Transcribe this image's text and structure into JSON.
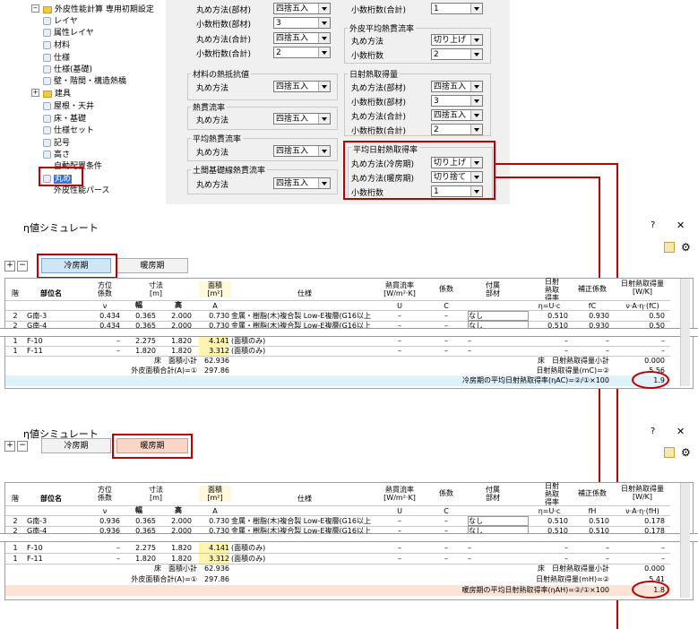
{
  "settings": {
    "tree": {
      "root": "外皮性能計算 専用初期設定",
      "items": [
        "レイヤ",
        "属性レイヤ",
        "材料",
        "仕様",
        "仕様(基礎)",
        "壁・階間・構造熱橋"
      ],
      "folder": "建具",
      "items2": [
        "屋根・天井",
        "床・基礎",
        "仕様セット",
        "記号",
        "高さ",
        "自動配置条件"
      ],
      "selected": "丸め",
      "last": "外皮性能パース"
    },
    "col1": {
      "top_rows": [
        {
          "label": "丸め方法(部材)",
          "value": "四捨五入"
        },
        {
          "label": "小数桁数(部材)",
          "value": "3"
        },
        {
          "label": "丸め方法(合計)",
          "value": "四捨五入"
        },
        {
          "label": "小数桁数(合計)",
          "value": "2"
        }
      ],
      "g_material": {
        "title": "材料の熱抵抗値",
        "label": "丸め方法",
        "value": "四捨五入"
      },
      "g_heatflow": {
        "title": "熱貫流率",
        "label": "丸め方法",
        "value": "四捨五入"
      },
      "g_avg_heat": {
        "title": "平均熱貫流率",
        "label": "丸め方法",
        "value": "四捨五入"
      },
      "g_ground": {
        "title": "土間基礎線熱貫流率",
        "label": "丸め方法",
        "value": "四捨五入"
      }
    },
    "col2": {
      "top_row": {
        "label": "小数桁数(合計)",
        "value": "1"
      },
      "g_skin": {
        "title": "外皮平均熱貫流率",
        "rows": [
          {
            "label": "丸め方法",
            "value": "切り上げ"
          },
          {
            "label": "小数桁数",
            "value": "2"
          }
        ]
      },
      "g_solar": {
        "title": "日射熱取得量",
        "rows": [
          {
            "label": "丸め方法(部材)",
            "value": "四捨五入"
          },
          {
            "label": "小数桁数(部材)",
            "value": "3"
          },
          {
            "label": "丸め方法(合計)",
            "value": "四捨五入"
          },
          {
            "label": "小数桁数(合計)",
            "value": "2"
          }
        ]
      },
      "g_avg_solar": {
        "title": "平均日射熱取得率",
        "rows": [
          {
            "label": "丸め方法(冷房期)",
            "value": "切り上げ"
          },
          {
            "label": "丸め方法(暖房期)",
            "value": "切り捨て"
          },
          {
            "label": "小数桁数",
            "value": "1"
          }
        ]
      }
    }
  },
  "sim1": {
    "title": "η値シミュレート",
    "help": "?",
    "close": "✕",
    "tab_cool": "冷房期",
    "tab_heat": "暖房期",
    "headers": {
      "kai": "階",
      "bui": "部位名",
      "houi": "方位\n係数",
      "sunpo": "寸法\n[m]",
      "haba": "幅",
      "taka": "高",
      "menseki": "面積\n[m²]",
      "shiyou": "仕様",
      "netsu": "熱貫流率\n[W/m²·K]",
      "keisu": "係数",
      "fuzoku": "付属\n部材",
      "nissha": "日射\n熱取\n得率",
      "hosei": "補正係数",
      "nissharyo": "日射熱取得量\n[W/K]"
    },
    "symbols": {
      "houi": "ν",
      "menseki": "A",
      "netsu": "U",
      "keisu": "C",
      "nissha": "η=U·c",
      "hosei": "fC",
      "nissharyo": "ν·A·η·(fC)"
    },
    "rows": [
      {
        "kai": "2",
        "bui": "G南-3",
        "houi": "0.434",
        "haba": "0.365",
        "taka": "2.000",
        "menseki": "0.730",
        "shiyou": "金属・樹脂(木)複合製 Low-E複層(G16以上",
        "netsu": "–",
        "keisu": "–",
        "fuzoku": "なし",
        "nissha": "0.510",
        "hosei": "0.930",
        "ryo": "0.50"
      },
      {
        "kai": "2",
        "bui": "G南-4",
        "houi": "0.434",
        "haba": "0.365",
        "taka": "2.000",
        "menseki": "0.730",
        "shiyou": "金属・樹脂(木)複合製 Low-E複層(G16以上",
        "netsu": "–",
        "keisu": "–",
        "fuzoku": "なし",
        "nissha": "0.510",
        "hosei": "0.930",
        "ryo": "0.50"
      },
      {
        "kai": "1",
        "bui": "F-10",
        "houi": "–",
        "haba": "2.275",
        "taka": "1.820",
        "menseki": "4.141",
        "shiyou": "(面積のみ)",
        "netsu": "–",
        "keisu": "–",
        "fuzoku": "–",
        "nissha": "–",
        "hosei": "–",
        "ryo": "–"
      },
      {
        "kai": "1",
        "bui": "F-11",
        "houi": "–",
        "haba": "1.820",
        "taka": "1.820",
        "menseki": "3.312",
        "shiyou": "(面積のみ)",
        "netsu": "–",
        "keisu": "–",
        "fuzoku": "–",
        "nissha": "–",
        "hosei": "–",
        "ryo": "–"
      }
    ],
    "floor_label": "床　面積小計",
    "floor_val": "62.936",
    "total_label": "外皮面積合計(A)=①",
    "total_val": "297.86",
    "floor_solar_label": "床　日射熱取得量小計",
    "floor_solar_val": "0.000",
    "solar_total_label": "日射熱取得量(mC)=②",
    "solar_total_val": "5.56",
    "result_label": "冷房期の平均日射熱取得率(ηAC)=②/①×100",
    "result_val": "1.9"
  },
  "sim2": {
    "title": "η値シミュレート",
    "help": "?",
    "close": "✕",
    "tab_cool": "冷房期",
    "tab_heat": "暖房期",
    "symbols": {
      "houi": "ν",
      "menseki": "A",
      "netsu": "U",
      "keisu": "C",
      "nissha": "η=U·c",
      "hosei": "fH",
      "nissharyo": "ν·A·η·(fH)"
    },
    "rows": [
      {
        "kai": "2",
        "bui": "G南-3",
        "houi": "0.936",
        "haba": "0.365",
        "taka": "2.000",
        "menseki": "0.730",
        "shiyou": "金属・樹脂(木)複合製 Low-E複層(G16以上",
        "netsu": "–",
        "keisu": "–",
        "fuzoku": "なし",
        "nissha": "0.510",
        "hosei": "0.510",
        "ryo": "0.178"
      },
      {
        "kai": "2",
        "bui": "G南-4",
        "houi": "0.936",
        "haba": "0.365",
        "taka": "2.000",
        "menseki": "0.730",
        "shiyou": "金属・樹脂(木)複合製 Low-E複層(G16以上",
        "netsu": "–",
        "keisu": "–",
        "fuzoku": "なし",
        "nissha": "0.510",
        "hosei": "0.510",
        "ryo": "0.178"
      },
      {
        "kai": "1",
        "bui": "F-10",
        "houi": "–",
        "haba": "2.275",
        "taka": "1.820",
        "menseki": "4.141",
        "shiyou": "(面積のみ)",
        "netsu": "–",
        "keisu": "–",
        "fuzoku": "–",
        "nissha": "–",
        "hosei": "–",
        "ryo": "–"
      },
      {
        "kai": "1",
        "bui": "F-11",
        "houi": "–",
        "haba": "1.820",
        "taka": "1.820",
        "menseki": "3.312",
        "shiyou": "(面積のみ)",
        "netsu": "–",
        "keisu": "–",
        "fuzoku": "–",
        "nissha": "–",
        "hosei": "–",
        "ryo": "–"
      }
    ],
    "floor_label": "床　面積小計",
    "floor_val": "62.936",
    "total_label": "外皮面積合計(A)=①",
    "total_val": "297.86",
    "floor_solar_label": "床　日射熱取得量小計",
    "floor_solar_val": "0.000",
    "solar_total_label": "日射熱取得量(mH)=②",
    "solar_total_val": "5.41",
    "result_label": "暖房期の平均日射熱取得率(ηAH)=②/①×100",
    "result_val": "1.8"
  },
  "colors": {
    "accent_red": "#c00000",
    "cool_row": "#dff1fb",
    "heat_row": "#fde3d6"
  }
}
